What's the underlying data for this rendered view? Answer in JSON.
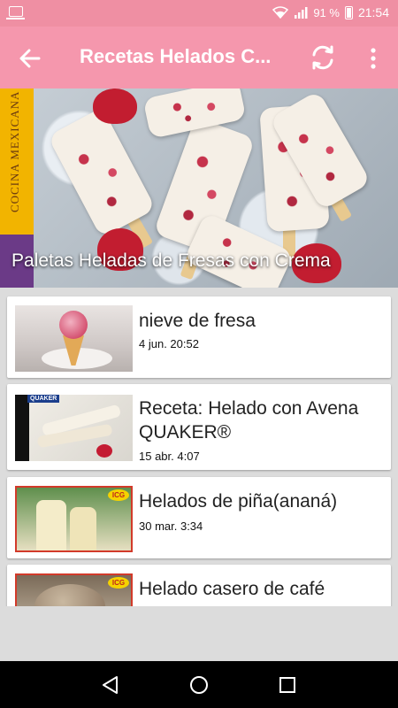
{
  "status_bar": {
    "battery": "91 %",
    "time": "21:54"
  },
  "app_bar": {
    "title": "Recetas Helados C..."
  },
  "hero": {
    "side_banner_text": "COCINA MEXICANA",
    "caption": "Paletas Heladas de Fresas con Crema"
  },
  "videos": [
    {
      "title": "nieve de fresa",
      "date": "4 jun. 20:52"
    },
    {
      "title": "Receta: Helado con Avena QUAKER®",
      "date": "15 abr. 4:07"
    },
    {
      "title": "Helados de piña(ananá)",
      "date": "30 mar. 3:34"
    },
    {
      "title": "Helado casero de café",
      "date": ""
    }
  ],
  "thumb_badges": {
    "quaker": "QUAKER",
    "icg": "ICG"
  },
  "colors": {
    "status_bar": "#ef8fa3",
    "app_bar": "#f597ad",
    "background": "#dcdcdc"
  },
  "icons": [
    "back-arrow-icon",
    "refresh-icon",
    "more-vert-icon",
    "wifi-icon",
    "signal-icon",
    "battery-icon",
    "nav-back-icon",
    "nav-home-icon",
    "nav-recents-icon"
  ]
}
